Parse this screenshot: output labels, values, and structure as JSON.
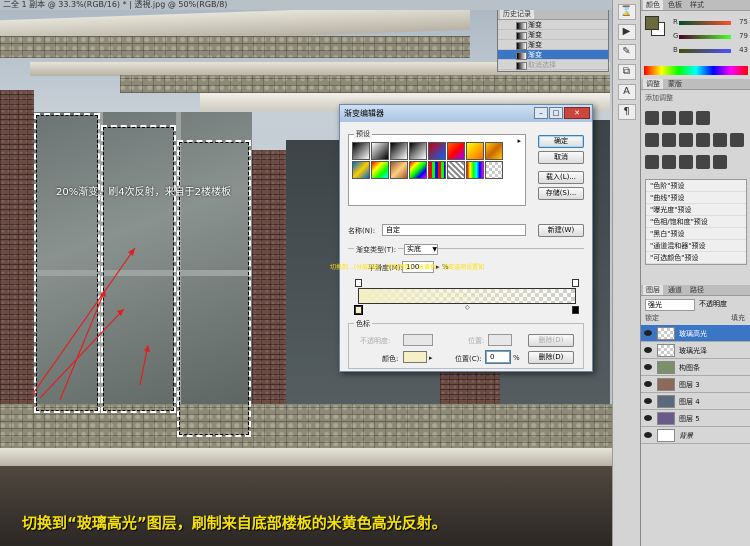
{
  "document": {
    "title": "二全 1 副本 @ 33.3%(RGB/16) *  |  透視.jpg @ 50%(RGB/8)"
  },
  "canvas": {
    "annotation": "20%渐变，刷4次反射，来自于2楼楼板",
    "caption": "切换到“玻璃高光”图层，刷制来自底部楼板的米黄色高光反射。",
    "dialog_overlay_note": "切换到...(分层选区，拾取颜色)...米黄色，渐变选项设置如"
  },
  "history_panel": {
    "title": "历史记录",
    "items": [
      {
        "label": "渐变",
        "state": "normal"
      },
      {
        "label": "渐变",
        "state": "normal"
      },
      {
        "label": "渐变",
        "state": "normal"
      },
      {
        "label": "渐变",
        "state": "active"
      },
      {
        "label": "取消选择",
        "state": "greyed"
      }
    ]
  },
  "color_panel": {
    "tabs": [
      "颜色",
      "色板",
      "样式"
    ],
    "channels": [
      {
        "label": "R",
        "value": "75"
      },
      {
        "label": "G",
        "value": "79"
      },
      {
        "label": "B",
        "value": "43"
      }
    ],
    "foreground_color": "#6b6a3a",
    "background_color": "#ffffff"
  },
  "adjustments_panel": {
    "tabs": [
      "调整",
      "蒙版"
    ],
    "subtitle": "添加调整",
    "presets": [
      "\"色阶\"预设",
      "\"曲线\"预设",
      "\"曝光度\"预设",
      "\"色相/饱和度\"预设",
      "\"黑白\"预设",
      "\"通道混和器\"预设",
      "\"可选颜色\"预设"
    ]
  },
  "layers_panel": {
    "tabs": [
      "图层",
      "通道",
      "路径"
    ],
    "blend_mode": "强光",
    "opacity_label": "不透明度",
    "lock_label": "锁定",
    "fill_label": "填充",
    "layers": [
      {
        "name": "玻璃高光",
        "active": true
      },
      {
        "name": "玻璃光泽",
        "active": false
      },
      {
        "name": "构图条",
        "active": false
      },
      {
        "name": "图层 3",
        "active": false
      },
      {
        "name": "图层 4",
        "active": false
      },
      {
        "name": "图层 5",
        "active": false
      },
      {
        "name": "背景",
        "active": false
      }
    ]
  },
  "gradient_editor": {
    "title": "渐变编辑器",
    "presets_label": "预设",
    "buttons": {
      "ok": "确定",
      "cancel": "取消",
      "load": "载入(L)...",
      "save": "存储(S)...",
      "new": "新建(W)",
      "delete": "删除(D)"
    },
    "name_label": "名称(N):",
    "name_value": "自定",
    "gradient_type_label": "渐变类型(T):",
    "gradient_type_value": "实底",
    "smoothness_label": "平滑度(M):",
    "smoothness_value": "100",
    "percent": "%",
    "stops_label": "色标",
    "opacity_label": "不透明度:",
    "location_label": "位置:",
    "color_label": "颜色:",
    "color_location_label": "位置(C):",
    "color_location_value": "0",
    "stop_color": "#f5f0c5"
  }
}
